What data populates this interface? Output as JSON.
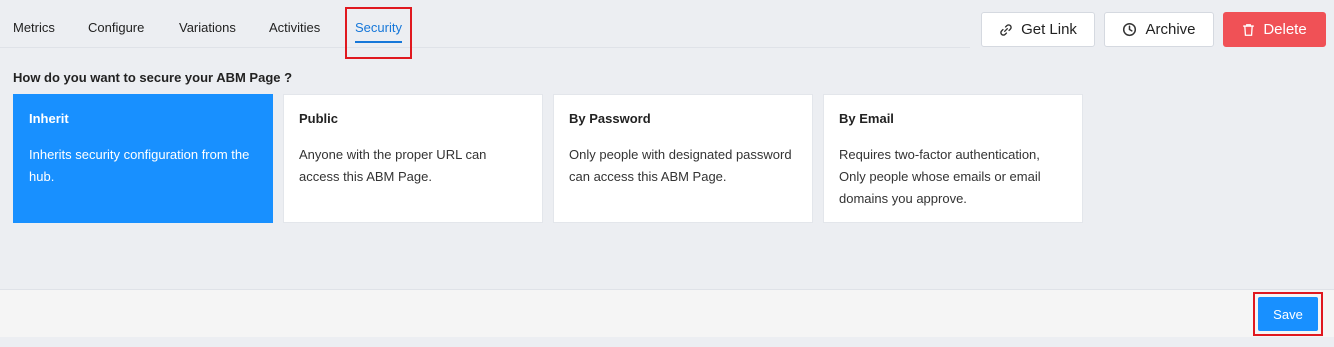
{
  "tabs": [
    {
      "label": "Metrics"
    },
    {
      "label": "Configure"
    },
    {
      "label": "Variations"
    },
    {
      "label": "Activities"
    },
    {
      "label": "Security"
    }
  ],
  "actions": {
    "get_link": "Get Link",
    "archive": "Archive",
    "delete": "Delete"
  },
  "question": "How do you want to secure your ABM Page ?",
  "options": [
    {
      "title": "Inherit",
      "desc": "Inherits security configuration from the hub."
    },
    {
      "title": "Public",
      "desc": "Anyone with the proper URL can access this ABM Page."
    },
    {
      "title": "By Password",
      "desc": "Only people with designated password can access this ABM Page."
    },
    {
      "title": "By Email",
      "desc": "Requires two-factor authentication, Only people whose emails or email domains you approve."
    }
  ],
  "footer": {
    "save": "Save"
  },
  "colors": {
    "accent": "#1890ff",
    "tab_active": "#1677d9",
    "danger": "#f05156",
    "highlight": "#e0181f"
  }
}
